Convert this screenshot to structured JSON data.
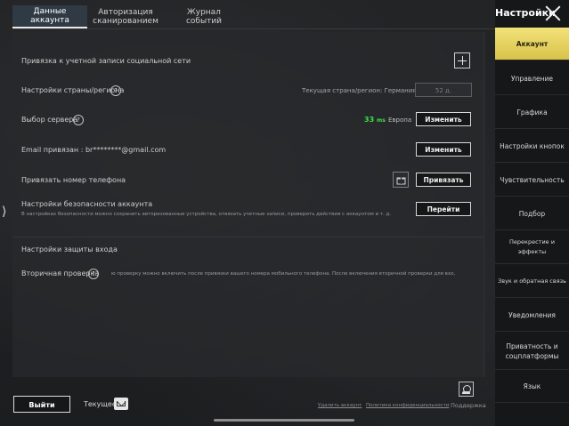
{
  "tabs": [
    {
      "label": "Данные аккаунта",
      "active": true
    },
    {
      "label": "Авторизация сканированием"
    },
    {
      "label": "Журнал событий"
    }
  ],
  "sidebar": {
    "title": "Настройки",
    "items": [
      {
        "label": "Аккаунт",
        "active": true
      },
      {
        "label": "Управление"
      },
      {
        "label": "Графика"
      },
      {
        "label": "Настройки кнопок"
      },
      {
        "label": "Чувствительность"
      },
      {
        "label": "Подбор"
      },
      {
        "label": "Перекрестие и эффекты"
      },
      {
        "label": "Звук и обратная связь"
      },
      {
        "label": "Уведомления"
      },
      {
        "label": "Приватность и соцплатформы"
      },
      {
        "label": "Язык"
      }
    ]
  },
  "main": {
    "social_link_label": "Привязка к учетной записи социальной сети",
    "region_label": "Настройки страны/региона",
    "region_current": "Текущая страна/регион: Германия",
    "region_days": "52 д.",
    "server_label": "Выбор сервера",
    "server_ping": "33",
    "server_ping_unit": "ms",
    "server_name": "Европа",
    "change_label": "Изменить",
    "email_label": "Email привязан : br********@gmail.com",
    "phone_label": "Привязать номер телефона",
    "bind_label": "Привязать",
    "security_label": "Настройки безопасности аккаунта",
    "security_desc": "В настройках безопасности можно сохранить авторизованные устройства, отвязать учетные записи, проверить действия с аккаунтом и т. д.",
    "go_label": "Перейти",
    "login_protect_label": "Настройки защиты входа",
    "second_check_label": "Вторичная проверка",
    "second_check_desc": "ю проверку можно включить после привязки вашего номера мобильного телефона. После включения вторичной проверки для вхо,"
  },
  "bottom": {
    "exit_label": "Выйти",
    "current_label": "Текущее",
    "delete_link": "Удалить аккаунт",
    "privacy_link": "Политика конфиденциальности",
    "support_label": "Поддержка"
  },
  "colors": {
    "accent": "#e6d35a",
    "ping": "#3fe04a"
  }
}
